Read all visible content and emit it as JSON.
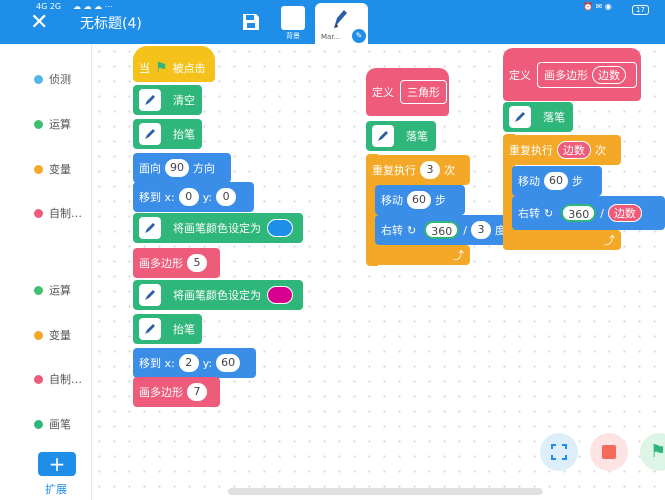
{
  "status": {
    "signal": "4G 2G",
    "wifi_battery": "17"
  },
  "header": {
    "title": "无标题(4)",
    "tabs": [
      {
        "label": "背景"
      },
      {
        "label": "Mar..."
      }
    ]
  },
  "sidebar": {
    "categories": [
      {
        "label": "侦测",
        "color": "#4fb7e6"
      },
      {
        "label": "运算",
        "color": "#3fbf6f"
      },
      {
        "label": "变量",
        "color": "#f4a827"
      },
      {
        "label": "自制…",
        "color": "#ef5b7a"
      },
      {
        "label": "运算",
        "color": "#3fbf6f"
      },
      {
        "label": "变量",
        "color": "#f4a827"
      },
      {
        "label": "自制…",
        "color": "#ef5b7a"
      },
      {
        "label": "画笔",
        "color": "#2fb67a"
      }
    ],
    "extend_label": "扩展"
  },
  "script1": {
    "hat": {
      "when": "当",
      "clicked": "被点击"
    },
    "clear": "清空",
    "pen_down": "抬笔",
    "face": {
      "label": "面向",
      "value": "90",
      "unit": "方向"
    },
    "goto1": {
      "label": "移到 x:",
      "x": "0",
      "ylabel": "y:",
      "y": "0"
    },
    "set_color1": {
      "label": "将画笔颜色设定为",
      "color": "#1e8ee8"
    },
    "polygon1": {
      "label": "画多边形",
      "value": "5"
    },
    "set_color2": {
      "label": "将画笔颜色设定为",
      "color": "#d6008f"
    },
    "pen_up": "抬笔",
    "goto2": {
      "label": "移到 x:",
      "x": "2",
      "ylabel": "y:",
      "y": "60"
    },
    "polygon2": {
      "label": "画多边形",
      "value": "7"
    }
  },
  "script2": {
    "define": "定义",
    "name": "三角形",
    "pen_down": "落笔",
    "repeat": {
      "label": "重复执行",
      "value": "3",
      "unit": "次"
    },
    "move": {
      "label": "移动",
      "value": "60",
      "unit": "步"
    },
    "turn": {
      "label": "右转",
      "num": "360",
      "slash": "/",
      "den": "3",
      "unit": "度"
    }
  },
  "script3": {
    "define": "定义",
    "name": "画多边形",
    "param": "边数",
    "pen_down": "落笔",
    "repeat": {
      "label": "重复执行",
      "param": "边数",
      "unit": "次"
    },
    "move": {
      "label": "移动",
      "value": "60",
      "unit": "步"
    },
    "turn": {
      "label": "右转",
      "num": "360",
      "slash": "/",
      "den": "边数"
    }
  }
}
